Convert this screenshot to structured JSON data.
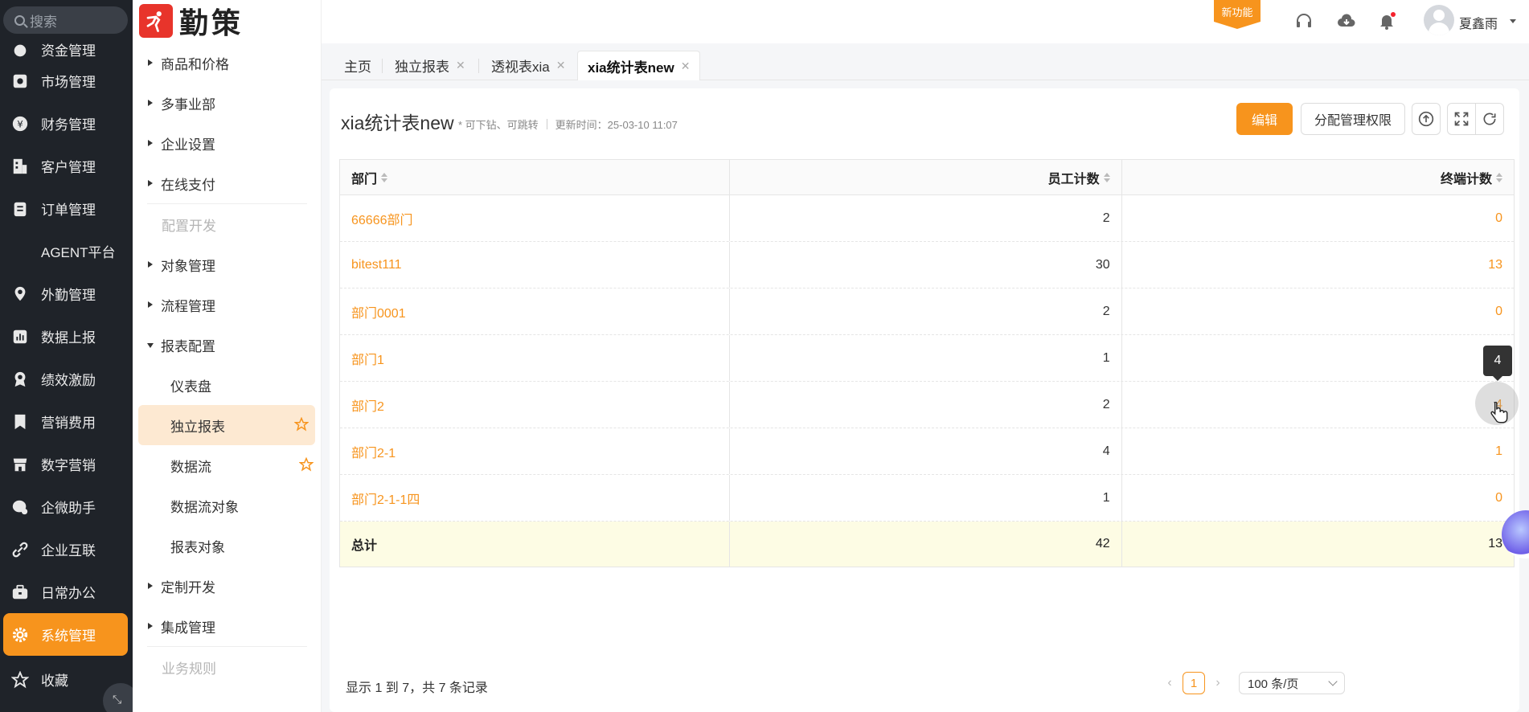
{
  "app": {
    "brand_name": "勤策",
    "search_placeholder": "搜索"
  },
  "left_nav": {
    "items": [
      {
        "label": "资金管理",
        "icon": "money-bag-icon"
      },
      {
        "label": "市场管理",
        "icon": "market-icon"
      },
      {
        "label": "财务管理",
        "icon": "yen-icon"
      },
      {
        "label": "客户管理",
        "icon": "building-icon"
      },
      {
        "label": "订单管理",
        "icon": "clipboard-icon"
      },
      {
        "label": "AGENT平台",
        "icon": ""
      },
      {
        "label": "外勤管理",
        "icon": "location-pin-icon"
      },
      {
        "label": "数据上报",
        "icon": "chart-report-icon"
      },
      {
        "label": "绩效激励",
        "icon": "medal-icon"
      },
      {
        "label": "营销费用",
        "icon": "bookmark-icon"
      },
      {
        "label": "数字营销",
        "icon": "store-icon"
      },
      {
        "label": "企微助手",
        "icon": "chat-icon"
      },
      {
        "label": "企业互联",
        "icon": "link-icon"
      },
      {
        "label": "日常办公",
        "icon": "briefcase-icon"
      },
      {
        "label": "系统管理",
        "icon": "gear-icon"
      },
      {
        "label": "收藏",
        "icon": "star-icon"
      }
    ],
    "active_color": "#f7941d"
  },
  "second_menu": {
    "items": [
      {
        "label": "商品和价格"
      },
      {
        "label": "多事业部"
      },
      {
        "label": "企业设置"
      },
      {
        "label": "在线支付"
      },
      {
        "label": "配置开发"
      },
      {
        "label": "对象管理"
      },
      {
        "label": "流程管理"
      },
      {
        "label": "报表配置"
      },
      {
        "label": "仪表盘"
      },
      {
        "label": "独立报表"
      },
      {
        "label": "数据流"
      },
      {
        "label": "数据流对象"
      },
      {
        "label": "报表对象"
      },
      {
        "label": "定制开发"
      },
      {
        "label": "集成管理"
      },
      {
        "label": "业务规则"
      }
    ]
  },
  "header": {
    "new_feature_label": "新功能",
    "user_name": "夏鑫雨"
  },
  "tabs": [
    {
      "label": "主页"
    },
    {
      "label": "独立报表"
    },
    {
      "label": "透视表xia"
    },
    {
      "label": "xia统计表new"
    }
  ],
  "report": {
    "title": "xia统计表new",
    "hint": "* 可下钻、可跳转",
    "updated": "更新时间：25-03-10 11:07",
    "edit_label": "编辑",
    "assign_label": "分配管理权限",
    "columns": [
      "部门",
      "员工计数",
      "终端计数"
    ],
    "rows": [
      {
        "dept": "66666部门",
        "employees": "2",
        "terminals": "0"
      },
      {
        "dept": "bitest111",
        "employees": "30",
        "terminals": "13"
      },
      {
        "dept": "部门0001",
        "employees": "2",
        "terminals": "0"
      },
      {
        "dept": "部门1",
        "employees": "1",
        "terminals": ""
      },
      {
        "dept": "部门2",
        "employees": "2",
        "terminals": "4"
      },
      {
        "dept": "部门2-1",
        "employees": "4",
        "terminals": "1"
      },
      {
        "dept": "部门2-1-1四",
        "employees": "1",
        "terminals": "0"
      }
    ],
    "total": {
      "label": "总计",
      "employees": "42",
      "terminals": "13"
    },
    "tooltip": "4",
    "footer": "显示 1 到 7，共 7 条记录",
    "page_current": "1",
    "page_size": "100 条/页"
  }
}
